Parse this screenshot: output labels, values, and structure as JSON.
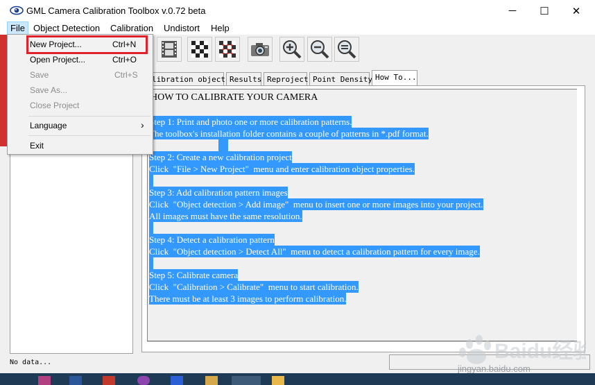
{
  "window": {
    "title": "GML Camera Calibration Toolbox  v.0.72 beta",
    "minimize_glyph": "─",
    "maximize_glyph": "☐",
    "close_glyph": "✕"
  },
  "menubar": {
    "file": "File",
    "object_detection": "Object Detection",
    "calibration": "Calibration",
    "undistort": "Undistort",
    "help": "Help"
  },
  "file_menu": {
    "new_project": {
      "label": "New Project...",
      "shortcut": "Ctrl+N"
    },
    "open_project": {
      "label": "Open Project...",
      "shortcut": "Ctrl+O"
    },
    "save": {
      "label": "Save",
      "shortcut": "Ctrl+S"
    },
    "save_as": {
      "label": "Save As..."
    },
    "close_project": {
      "label": "Close Project"
    },
    "language": {
      "label": "Language",
      "arrow": "›"
    },
    "exit": {
      "label": "Exit"
    }
  },
  "tabs": [
    "libration object",
    "Results",
    "Reproject",
    "Point Density",
    "How To..."
  ],
  "content": {
    "heading": "HOW TO CALIBRATE YOUR CAMERA",
    "lines": [
      "Step 1: Print and photo one or more calibration patterns.",
      "The toolbox's installation folder contains a couple of patterns in *.pdf format.",
      "",
      "Step 2: Create a new calibration project",
      "Click  \"File > New Project\"  menu and enter calibration object properties.",
      "",
      "Step 3: Add calibration pattern images",
      "Click  \"Object detection > Add image\"  menu to insert one or more images into your project.",
      "All images must have the same resolution.",
      "",
      "Step 4: Detect a calibration pattern",
      "Click  \"Object detection > Detect All\"  menu to detect a calibration pattern for every image.",
      "",
      "Step 5: Calibrate camera",
      "Click  \"Calibration > Calibrate\"  menu to start calibration.",
      "There must be at least 3 images to perform calibration."
    ]
  },
  "toolbar_icons": [
    "film-icon",
    "checkerboard-icon",
    "checkerboard-points-icon",
    "camera-icon",
    "zoom-in-icon",
    "zoom-out-icon",
    "zoom-reset-icon"
  ],
  "status": {
    "text": "No data..."
  },
  "watermark": {
    "text": "Baidu经验",
    "url": "jingyan.baidu.com"
  },
  "colors": {
    "selection": "#3399ff",
    "highlight_box": "#e0202a",
    "menu_active": "#cce8ff"
  }
}
